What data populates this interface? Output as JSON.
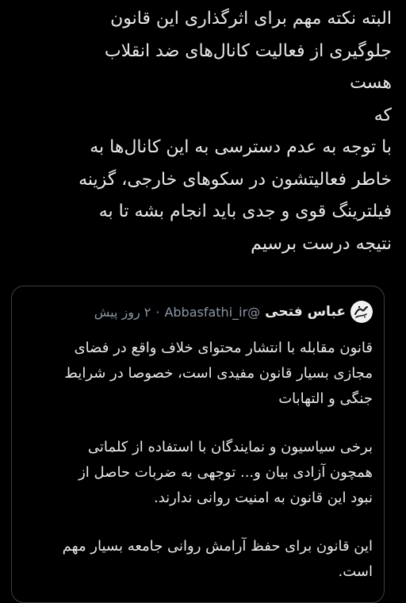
{
  "tweet": {
    "lines": [
      "البته نکته مهم برای اثرگذاری این قانون",
      "جلوگیری از فعالیت کانال‌های ضد انقلاب",
      "هست",
      "که",
      "با توجه به عدم دسترسی به این کانال‌ها به",
      "خاطر فعالیتشون در سکوهای خارجی، گزینه",
      "فیلترینگ قوی و جدی باید انجام بشه تا به",
      "نتیجه درست برسیم"
    ]
  },
  "quoted_tweet": {
    "author_name": "عباس فتحی",
    "author_handle": "@Abbasfathi_ir",
    "separator": "·",
    "time": "۲ روز پیش",
    "avatar_icon": "calligraphy-logo-icon",
    "paragraphs": [
      {
        "lines": [
          "قانون مقابله با انتشار محتوای خلاف واقع در فضای",
          "مجازی بسیار قانون مفیدی است، خصوصا در شرایط",
          "جنگی و التهابات"
        ]
      },
      {
        "lines": [
          "برخی سیاسیون و نمایندگان با استفاده از کلماتی",
          "همچون آزادی بیان و... توجهی به ضربات حاصل از",
          "نبود این قانون به امنیت روانی ندارند."
        ]
      },
      {
        "lines": [
          "این قانون برای حفظ آرامش روانی جامعه بسیار مهم",
          "است."
        ]
      }
    ]
  },
  "colors": {
    "background": "#000000",
    "text": "#e7e9ea",
    "secondary_text": "#8b98a5",
    "border": "#3a3f44"
  }
}
